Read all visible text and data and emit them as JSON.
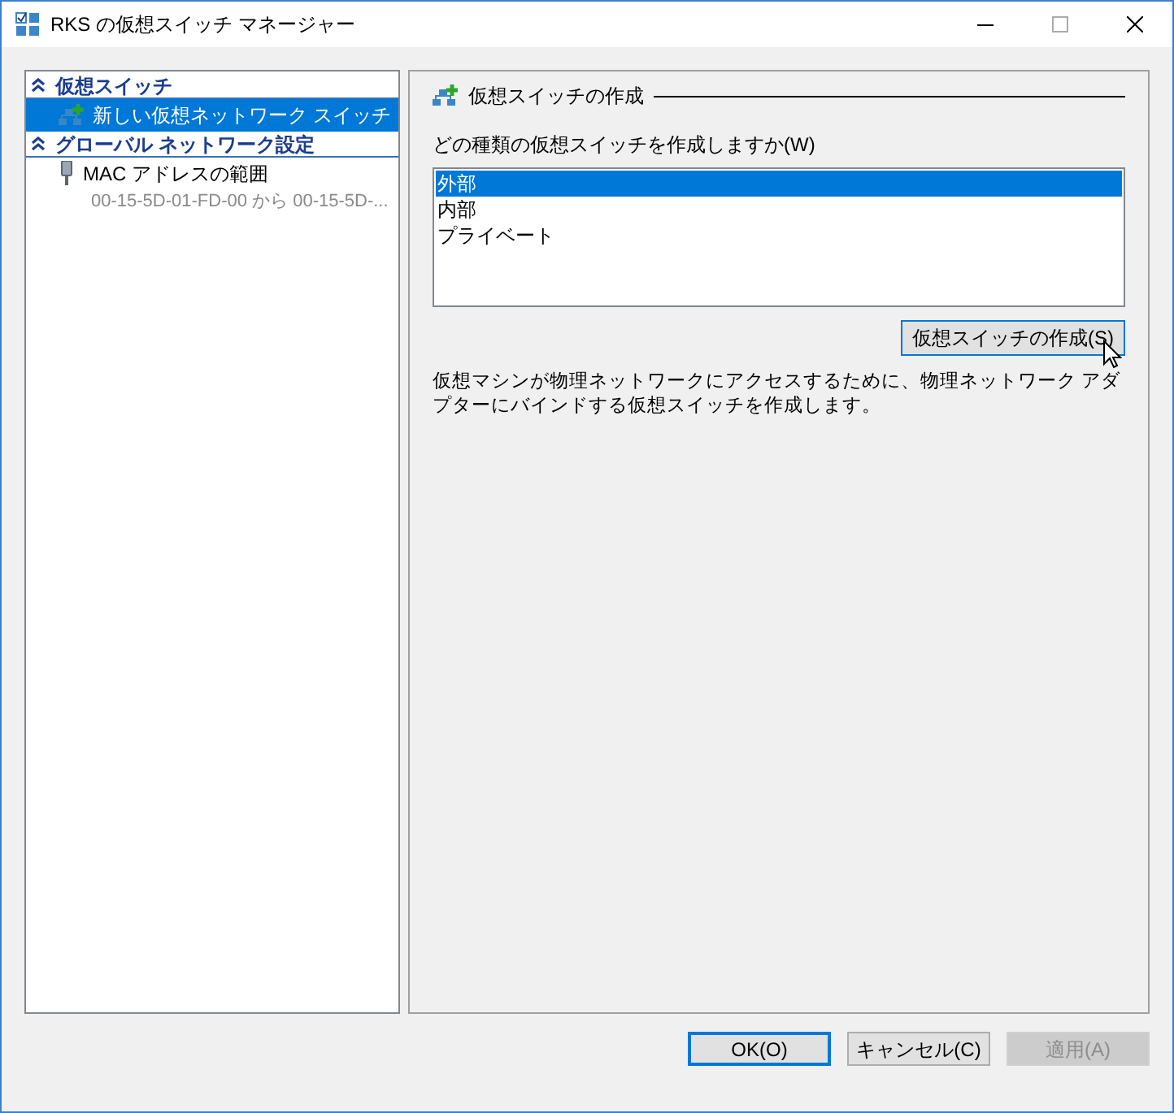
{
  "window": {
    "title": "RKS の仮想スイッチ マネージャー"
  },
  "tree": [
    {
      "label": "仮想スイッチ",
      "expanded": true,
      "children": [
        {
          "kind": "switch",
          "label": "新しい仮想ネットワーク スイッチ",
          "selected": true
        }
      ]
    },
    {
      "label": "グローバル ネットワーク設定",
      "expanded": true,
      "children": [
        {
          "kind": "mac",
          "label": "MAC アドレスの範囲",
          "detail": "00-15-5D-01-FD-00 から 00-15-5D-...",
          "selected": false
        }
      ]
    }
  ],
  "panel": {
    "title": "仮想スイッチの作成",
    "question": "どの種類の仮想スイッチを作成しますか(W)",
    "options": [
      {
        "label": "外部",
        "selected": true
      },
      {
        "label": "内部",
        "selected": false
      },
      {
        "label": "プライベート",
        "selected": false
      }
    ],
    "create_button": "仮想スイッチの作成(S)",
    "description": "仮想マシンが物理ネットワークにアクセスするために、物理ネットワーク アダプターにバインドする仮想スイッチを作成します。"
  },
  "buttons": [
    {
      "label": "OK(O)",
      "default": true,
      "disabled": false
    },
    {
      "label": "キャンセル(C)",
      "default": false,
      "disabled": false
    },
    {
      "label": "適用(A)",
      "default": false,
      "disabled": true
    }
  ]
}
